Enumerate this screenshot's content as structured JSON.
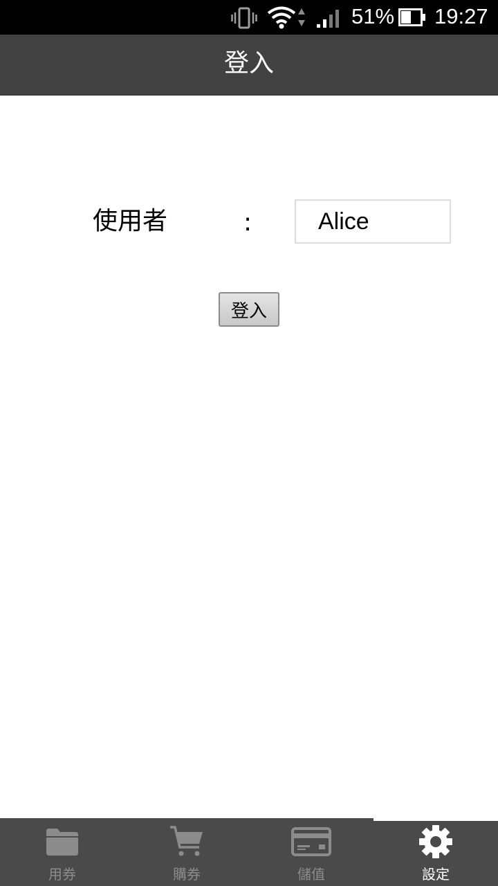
{
  "status_bar": {
    "battery_percent": "51%",
    "time": "19:27",
    "icons": [
      "vibrate-icon",
      "wifi-icon",
      "data-arrows-icon",
      "signal-icon",
      "battery-icon"
    ],
    "battery_level": 0.51
  },
  "app_bar": {
    "title": "登入"
  },
  "form": {
    "user_label": "使用者",
    "colon": ":",
    "user_value": "Alice",
    "login_button_label": "登入"
  },
  "bottom_nav": {
    "items": [
      {
        "label": "用券",
        "icon": "folder-icon",
        "active": false
      },
      {
        "label": "購券",
        "icon": "cart-icon",
        "active": false
      },
      {
        "label": "儲值",
        "icon": "card-icon",
        "active": false
      },
      {
        "label": "設定",
        "icon": "gear-icon",
        "active": true
      }
    ],
    "colors": {
      "active": "#ffffff",
      "inactive": "#8c8c8c",
      "background": "#4a4a4a"
    }
  },
  "colors": {
    "status_bar": "#000000",
    "app_bar": "#424242"
  }
}
